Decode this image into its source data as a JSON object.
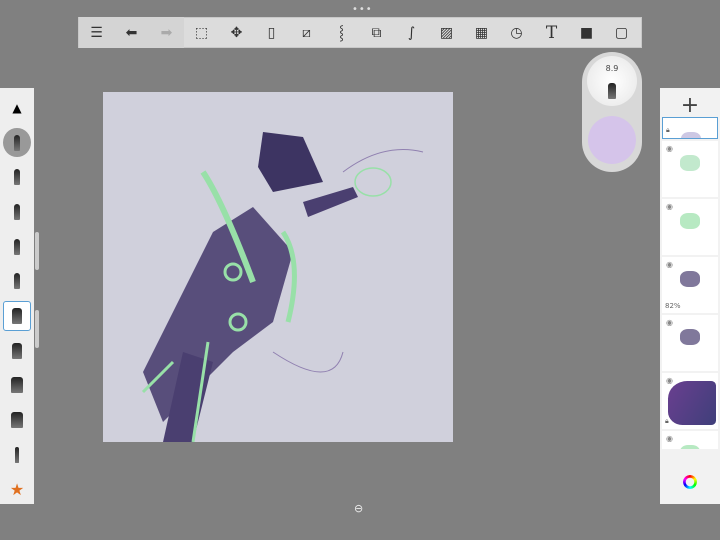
{
  "toolbar": {
    "items": [
      {
        "name": "layer-list",
        "glyph": "☰"
      },
      {
        "name": "undo",
        "glyph": "⬅"
      },
      {
        "name": "redo",
        "glyph": "➡"
      },
      {
        "name": "select",
        "glyph": "⬚"
      },
      {
        "name": "transform",
        "glyph": "✥"
      },
      {
        "name": "fill",
        "glyph": "▯"
      },
      {
        "name": "ruler",
        "glyph": "⧄"
      },
      {
        "name": "symmetry",
        "glyph": "⸾"
      },
      {
        "name": "shapes",
        "glyph": "⧉"
      },
      {
        "name": "curve",
        "glyph": "∫"
      },
      {
        "name": "add-image",
        "glyph": "▨"
      },
      {
        "name": "perspective",
        "glyph": "▦"
      },
      {
        "name": "time-lapse",
        "glyph": "◷"
      },
      {
        "name": "text",
        "glyph": "T"
      },
      {
        "name": "record",
        "glyph": "■"
      },
      {
        "name": "fullscreen",
        "glyph": "▢"
      }
    ]
  },
  "brush_puck": {
    "size": "8.9",
    "color": "#d5c4ea"
  },
  "layers": {
    "add_label": "+",
    "items": [
      {
        "visible": true,
        "locked": true,
        "selected": true
      },
      {
        "visible": true
      },
      {
        "visible": true
      },
      {
        "visible": true,
        "opacity": "82%"
      },
      {
        "visible": true
      },
      {
        "visible": true,
        "locked": true
      },
      {
        "visible": true
      }
    ]
  },
  "canvas": {
    "background": "#d0d0dc"
  }
}
